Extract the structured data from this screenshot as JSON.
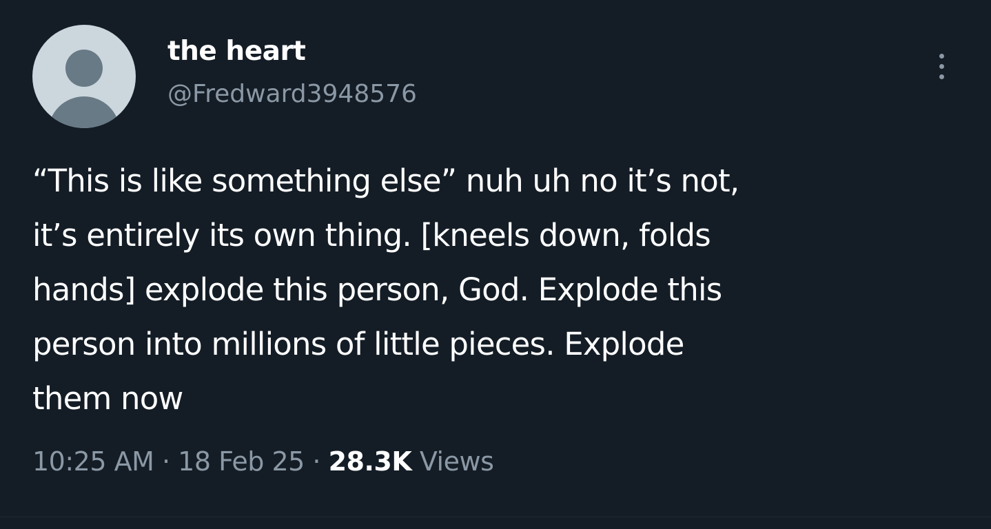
{
  "tweet": {
    "author": {
      "display_name": "the heart",
      "handle": "@Fredward3948576",
      "avatar_icon": "default-profile-icon"
    },
    "more_icon": "more-vertical-icon",
    "text_lines": [
      "“This is like something else” nuh uh no it’s not,",
      "it’s entirely its own thing. [kneels down, folds",
      "hands] explode this person, God. Explode this",
      "person into millions of little pieces. Explode",
      "them now"
    ],
    "time": "10:25 AM",
    "date": "18 Feb 25",
    "separator": "·",
    "views_count": "28.3K",
    "views_label": "Views"
  },
  "colors": {
    "background": "#141d26",
    "primary_text": "#ffffff",
    "secondary_text": "#8b98a5",
    "avatar_bg": "#ccd6dd",
    "avatar_fg": "#687a86"
  }
}
